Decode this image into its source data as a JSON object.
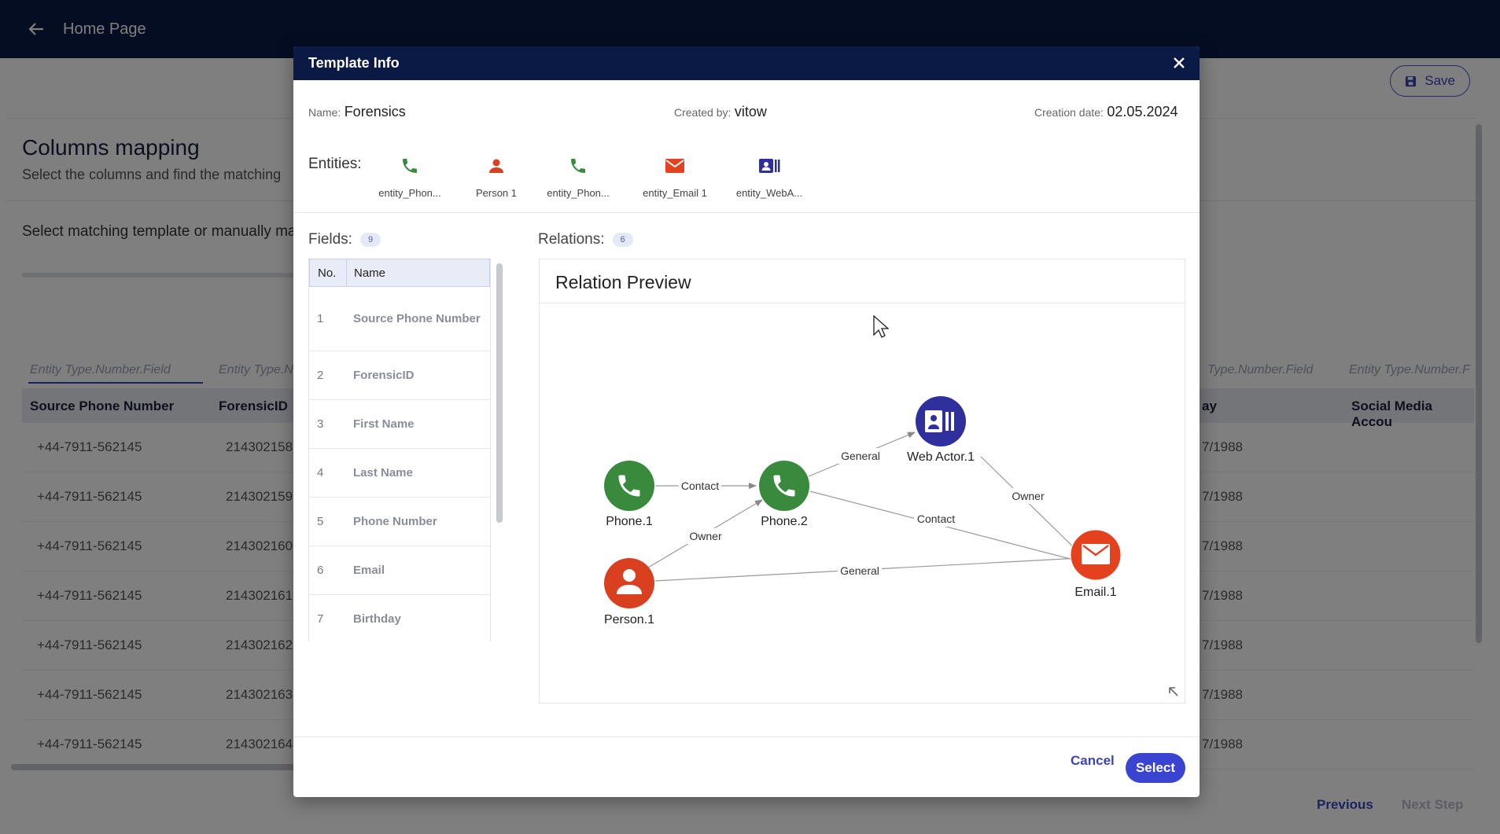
{
  "app": {
    "title": "Home Page",
    "save_label": "Save"
  },
  "page": {
    "heading": "Columns mapping",
    "subheading": "Select the columns and find the matching",
    "select_prompt": "Select matching template or manually ma",
    "nav_previous": "Previous",
    "nav_next": "Next Step"
  },
  "grid": {
    "placeholders": [
      "Entity Type.Number.Field",
      "Entity Type.N",
      "Type.Number.Field",
      "Entity Type.Number.F"
    ],
    "headers": [
      "Source Phone Number",
      "ForensicID",
      "ay",
      "Social Media Accou"
    ],
    "rows": [
      [
        "+44-7911-562145",
        "214302158",
        "7/1988"
      ],
      [
        "+44-7911-562145",
        "214302159",
        "7/1988"
      ],
      [
        "+44-7911-562145",
        "214302160",
        "7/1988"
      ],
      [
        "+44-7911-562145",
        "214302161",
        "7/1988"
      ],
      [
        "+44-7911-562145",
        "214302162",
        "7/1988"
      ],
      [
        "+44-7911-562145",
        "214302163",
        "7/1988"
      ],
      [
        "+44-7911-562145",
        "214302164",
        "7/1988"
      ]
    ]
  },
  "modal": {
    "title": "Template Info",
    "name_label": "Name:",
    "name_value": "Forensics",
    "created_by_label": "Created by:",
    "created_by_value": "vitow",
    "creation_date_label": "Creation date:",
    "creation_date_value": "02.05.2024",
    "entities_label": "Entities:",
    "entities": [
      {
        "label": "entity_Phon...",
        "icon": "phone-icon",
        "color": "#3a8a3e"
      },
      {
        "label": "Person 1",
        "icon": "person-icon",
        "color": "#d8401f"
      },
      {
        "label": "entity_Phon...",
        "icon": "phone-icon",
        "color": "#3a8a3e"
      },
      {
        "label": "entity_Email 1",
        "icon": "email-icon",
        "color": "#e4421f"
      },
      {
        "label": "entity_WebA...",
        "icon": "web-actor-icon",
        "color": "#2f2f9e"
      }
    ],
    "fields_label": "Fields:",
    "fields_count": "9",
    "relations_label": "Relations:",
    "relations_count": "6",
    "fields_table": {
      "col_no": "No.",
      "col_name": "Name",
      "rows": [
        {
          "no": "1",
          "name": "Source Phone Number"
        },
        {
          "no": "2",
          "name": "ForensicID"
        },
        {
          "no": "3",
          "name": "First Name"
        },
        {
          "no": "4",
          "name": "Last Name"
        },
        {
          "no": "5",
          "name": "Phone Number"
        },
        {
          "no": "6",
          "name": "Email"
        },
        {
          "no": "7",
          "name": "Birthday"
        }
      ]
    },
    "relation_preview_title": "Relation Preview",
    "graph": {
      "nodes": [
        {
          "id": "phone1",
          "label": "Phone.1",
          "icon": "phone-icon",
          "color": "#3a8a3e"
        },
        {
          "id": "phone2",
          "label": "Phone.2",
          "icon": "phone-icon",
          "color": "#3a8a3e"
        },
        {
          "id": "webactor1",
          "label": "Web Actor.1",
          "icon": "web-actor-icon",
          "color": "#2f2f9e"
        },
        {
          "id": "person1",
          "label": "Person.1",
          "icon": "person-icon",
          "color": "#d8401f"
        },
        {
          "id": "email1",
          "label": "Email.1",
          "icon": "email-icon",
          "color": "#e4421f"
        }
      ],
      "edges": [
        {
          "from": "phone1",
          "to": "phone2",
          "label": "Contact"
        },
        {
          "from": "phone2",
          "to": "webactor1",
          "label": "General"
        },
        {
          "from": "webactor1",
          "to": "email1",
          "label": "Owner"
        },
        {
          "from": "phone2",
          "to": "email1",
          "label": "Contact"
        },
        {
          "from": "person1",
          "to": "phone2",
          "label": "Owner"
        },
        {
          "from": "person1",
          "to": "email1",
          "label": "General"
        }
      ]
    },
    "cancel_label": "Cancel",
    "select_label": "Select"
  }
}
